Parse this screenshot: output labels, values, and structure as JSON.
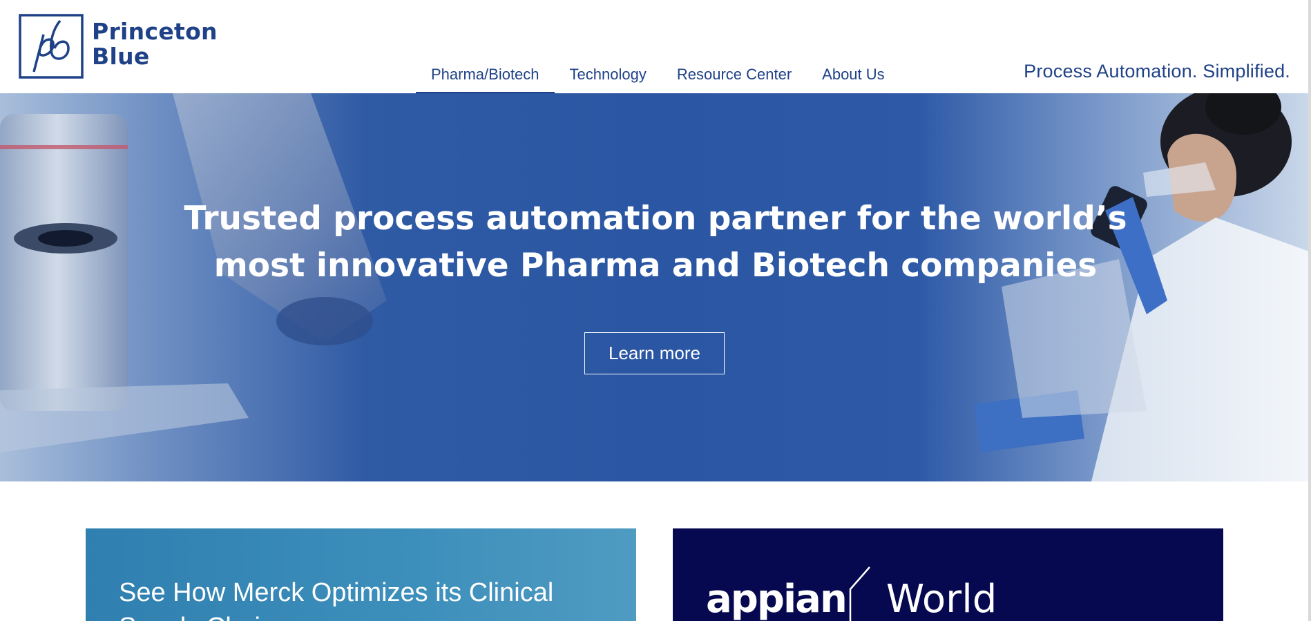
{
  "header": {
    "logo": {
      "mark_text": "pb",
      "line1": "Princeton",
      "line2": "Blue"
    },
    "nav": [
      {
        "label": "Pharma/Biotech",
        "active": true
      },
      {
        "label": "Technology",
        "active": false
      },
      {
        "label": "Resource Center",
        "active": false
      },
      {
        "label": "About Us",
        "active": false
      }
    ],
    "tagline": "Process Automation. Simplified."
  },
  "hero": {
    "title_line1": "Trusted process automation partner for the world’s",
    "title_line2": "most innovative Pharma and Biotech companies",
    "button_label": "Learn more"
  },
  "cards": {
    "left_title": "See How Merck Optimizes its Clinical Supply Chain",
    "right_brand": "appian",
    "right_event": "World"
  },
  "colors": {
    "brand_blue": "#1f4187",
    "hero_blue": "#2a56a3",
    "appian_navy": "#06094f",
    "card_teal": "#3d8fbb"
  }
}
